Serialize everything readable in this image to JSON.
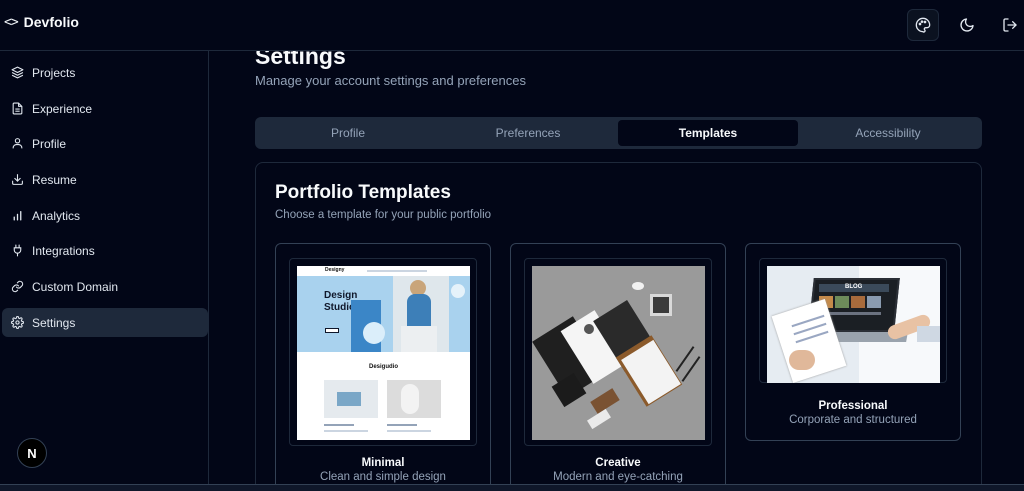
{
  "app": {
    "brand_symbol": "<>",
    "brand_name": "Devfolio"
  },
  "sidebar": {
    "items": [
      {
        "label": "Projects",
        "icon": "layers-icon"
      },
      {
        "label": "Experience",
        "icon": "file-text-icon"
      },
      {
        "label": "Profile",
        "icon": "user-icon"
      },
      {
        "label": "Resume",
        "icon": "download-icon"
      },
      {
        "label": "Analytics",
        "icon": "bar-chart-icon"
      },
      {
        "label": "Integrations",
        "icon": "plug-icon"
      },
      {
        "label": "Custom Domain",
        "icon": "link-icon"
      },
      {
        "label": "Settings",
        "icon": "gear-icon",
        "active": true
      }
    ],
    "avatar_letter": "N"
  },
  "header_actions": [
    "palette-icon",
    "moon-icon",
    "logout-icon"
  ],
  "page": {
    "title": "Settings",
    "subtitle": "Manage your account settings and preferences"
  },
  "tabs": [
    {
      "label": "Profile"
    },
    {
      "label": "Preferences"
    },
    {
      "label": "Templates",
      "active": true
    },
    {
      "label": "Accessibility"
    }
  ],
  "templates_card": {
    "title": "Portfolio Templates",
    "description": "Choose a template for your public portfolio",
    "templates": [
      {
        "name": "Minimal",
        "description": "Clean and simple design",
        "preview": {
          "brand": "Designy",
          "hero": "Design Studio",
          "section": "Desigudio"
        }
      },
      {
        "name": "Creative",
        "description": "Modern and eye-catching"
      },
      {
        "name": "Professional",
        "description": "Corporate and structured",
        "preview": {
          "screen_text": "BLOG"
        }
      }
    ]
  },
  "colors": {
    "background": "#020617",
    "panel_border": "#1e293b",
    "muted_text": "#94a3b8",
    "active_bg": "#1e293b",
    "accent_blue": "#a9d2ee"
  }
}
